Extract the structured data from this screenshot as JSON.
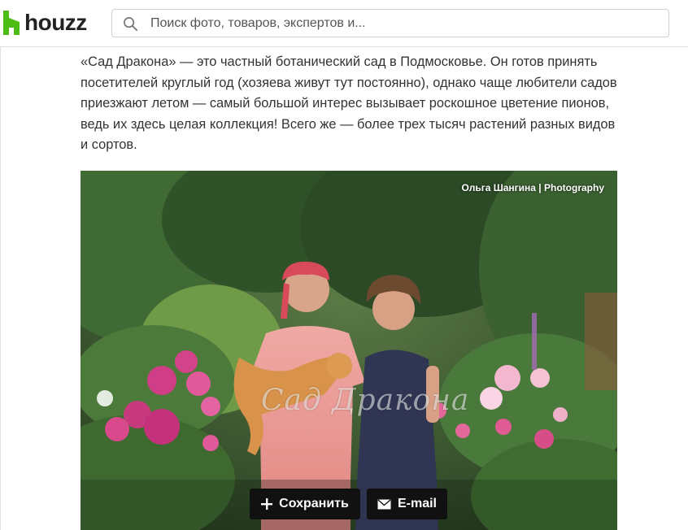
{
  "header": {
    "logo_text": "houzz",
    "search_placeholder": "Поиск фото, товаров, экспертов и..."
  },
  "article": {
    "paragraph": "«Сад Дракона» — это частный ботанический сад в Подмосковье. Он готов принять посетителей круглый год (хозяева живут тут постоянно), однако чаще любители садов приезжают летом — самый большой интерес вызывает роскошное цветение пионов, ведь их здесь целая коллекция! Всего же — более трех тысяч растений разных видов и сортов."
  },
  "photo": {
    "credit": "Ольга Шангина | Photography",
    "watermark": "Сад Дракона",
    "save_label": "Сохранить",
    "email_label": "E-mail"
  },
  "colors": {
    "brand": "#4dbc15",
    "button_bg": "#111111",
    "text": "#333333"
  }
}
